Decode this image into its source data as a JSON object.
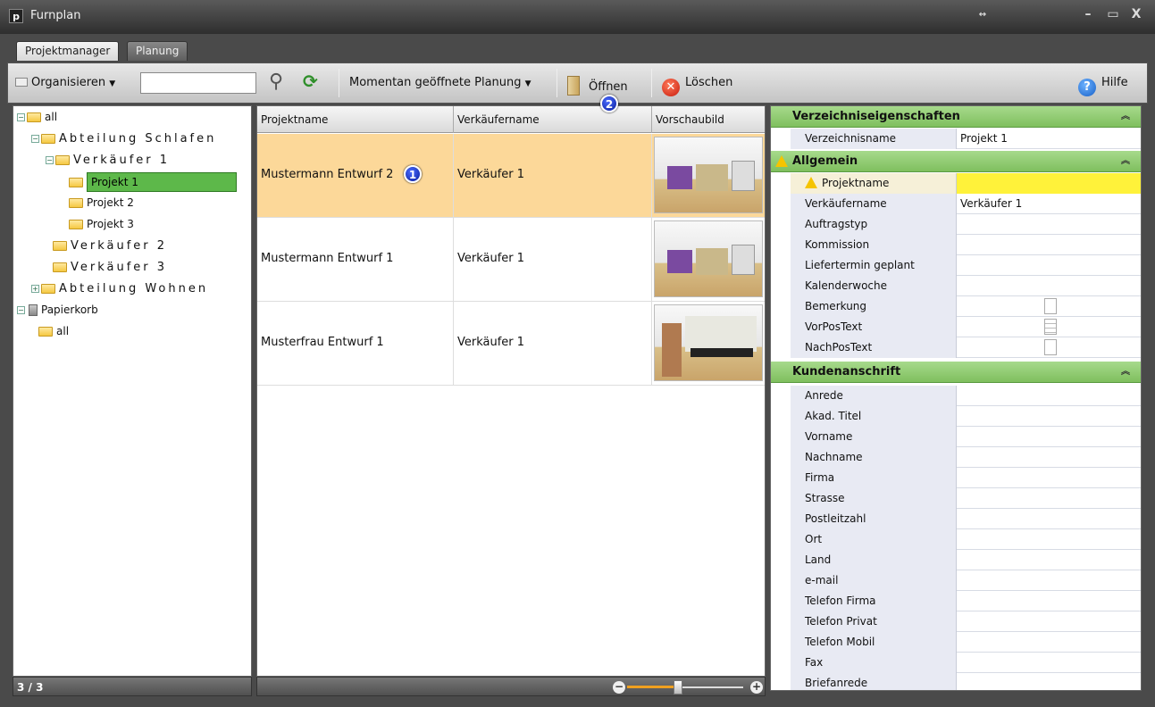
{
  "window": {
    "title": "Furnplan",
    "app_icon_text": "p"
  },
  "tabs": [
    {
      "label": "Projektmanager"
    },
    {
      "label": "Planung"
    }
  ],
  "toolbar": {
    "organize_label": "Organisieren",
    "search_value": "",
    "open_planning_label": "Momentan geöffnete Planung",
    "open_label": "Öffnen",
    "delete_label": "Löschen",
    "help_label": "Hilfe"
  },
  "tree": {
    "root": "all",
    "dept1": "Abteilung Schlafen",
    "seller1": "Verkäufer 1",
    "project1": "Projekt 1",
    "project2": "Projekt 2",
    "project3": "Projekt 3",
    "seller2": "Verkäufer 2",
    "seller3": "Verkäufer 3",
    "dept2": "Abteilung Wohnen",
    "trash": "Papierkorb",
    "trash_all": "all"
  },
  "status": {
    "count": "3 / 3"
  },
  "grid": {
    "columns": [
      "Projektname",
      "Verkäufername",
      "Vorschaubild"
    ],
    "rows": [
      {
        "name": "Mustermann Entwurf 2",
        "seller": "Verkäufer 1"
      },
      {
        "name": "Mustermann Entwurf 1",
        "seller": "Verkäufer 1"
      },
      {
        "name": "Musterfrau Entwurf 1",
        "seller": "Verkäufer 1"
      }
    ]
  },
  "badges": {
    "b1": "1",
    "b2": "2"
  },
  "props": {
    "section1": "Verzeichniseigenschaften",
    "dir_name_label": "Verzeichnisname",
    "dir_name_value": "Projekt 1",
    "section2": "Allgemein",
    "general": [
      {
        "label": "Projektname",
        "value": ""
      },
      {
        "label": "Verkäufername",
        "value": "Verkäufer 1"
      },
      {
        "label": "Auftragstyp",
        "value": ""
      },
      {
        "label": "Kommission",
        "value": ""
      },
      {
        "label": "Liefertermin geplant",
        "value": ""
      },
      {
        "label": "Kalenderwoche",
        "value": ""
      },
      {
        "label": "Bemerkung",
        "value": ""
      },
      {
        "label": "VorPosText",
        "value": ""
      },
      {
        "label": "NachPosText",
        "value": ""
      }
    ],
    "section3": "Kundenanschrift",
    "customer": [
      {
        "label": "Anrede"
      },
      {
        "label": "Akad. Titel"
      },
      {
        "label": "Vorname"
      },
      {
        "label": "Nachname"
      },
      {
        "label": "Firma"
      },
      {
        "label": "Strasse"
      },
      {
        "label": "Postleitzahl"
      },
      {
        "label": "Ort"
      },
      {
        "label": "Land"
      },
      {
        "label": "e-mail"
      },
      {
        "label": "Telefon Firma"
      },
      {
        "label": "Telefon Privat"
      },
      {
        "label": "Telefon Mobil"
      },
      {
        "label": "Fax"
      },
      {
        "label": "Briefanrede"
      }
    ]
  },
  "colors": {
    "accent_green": "#7fbf5e",
    "selection": "#fcd899",
    "highlight_yellow": "#fff23a"
  }
}
